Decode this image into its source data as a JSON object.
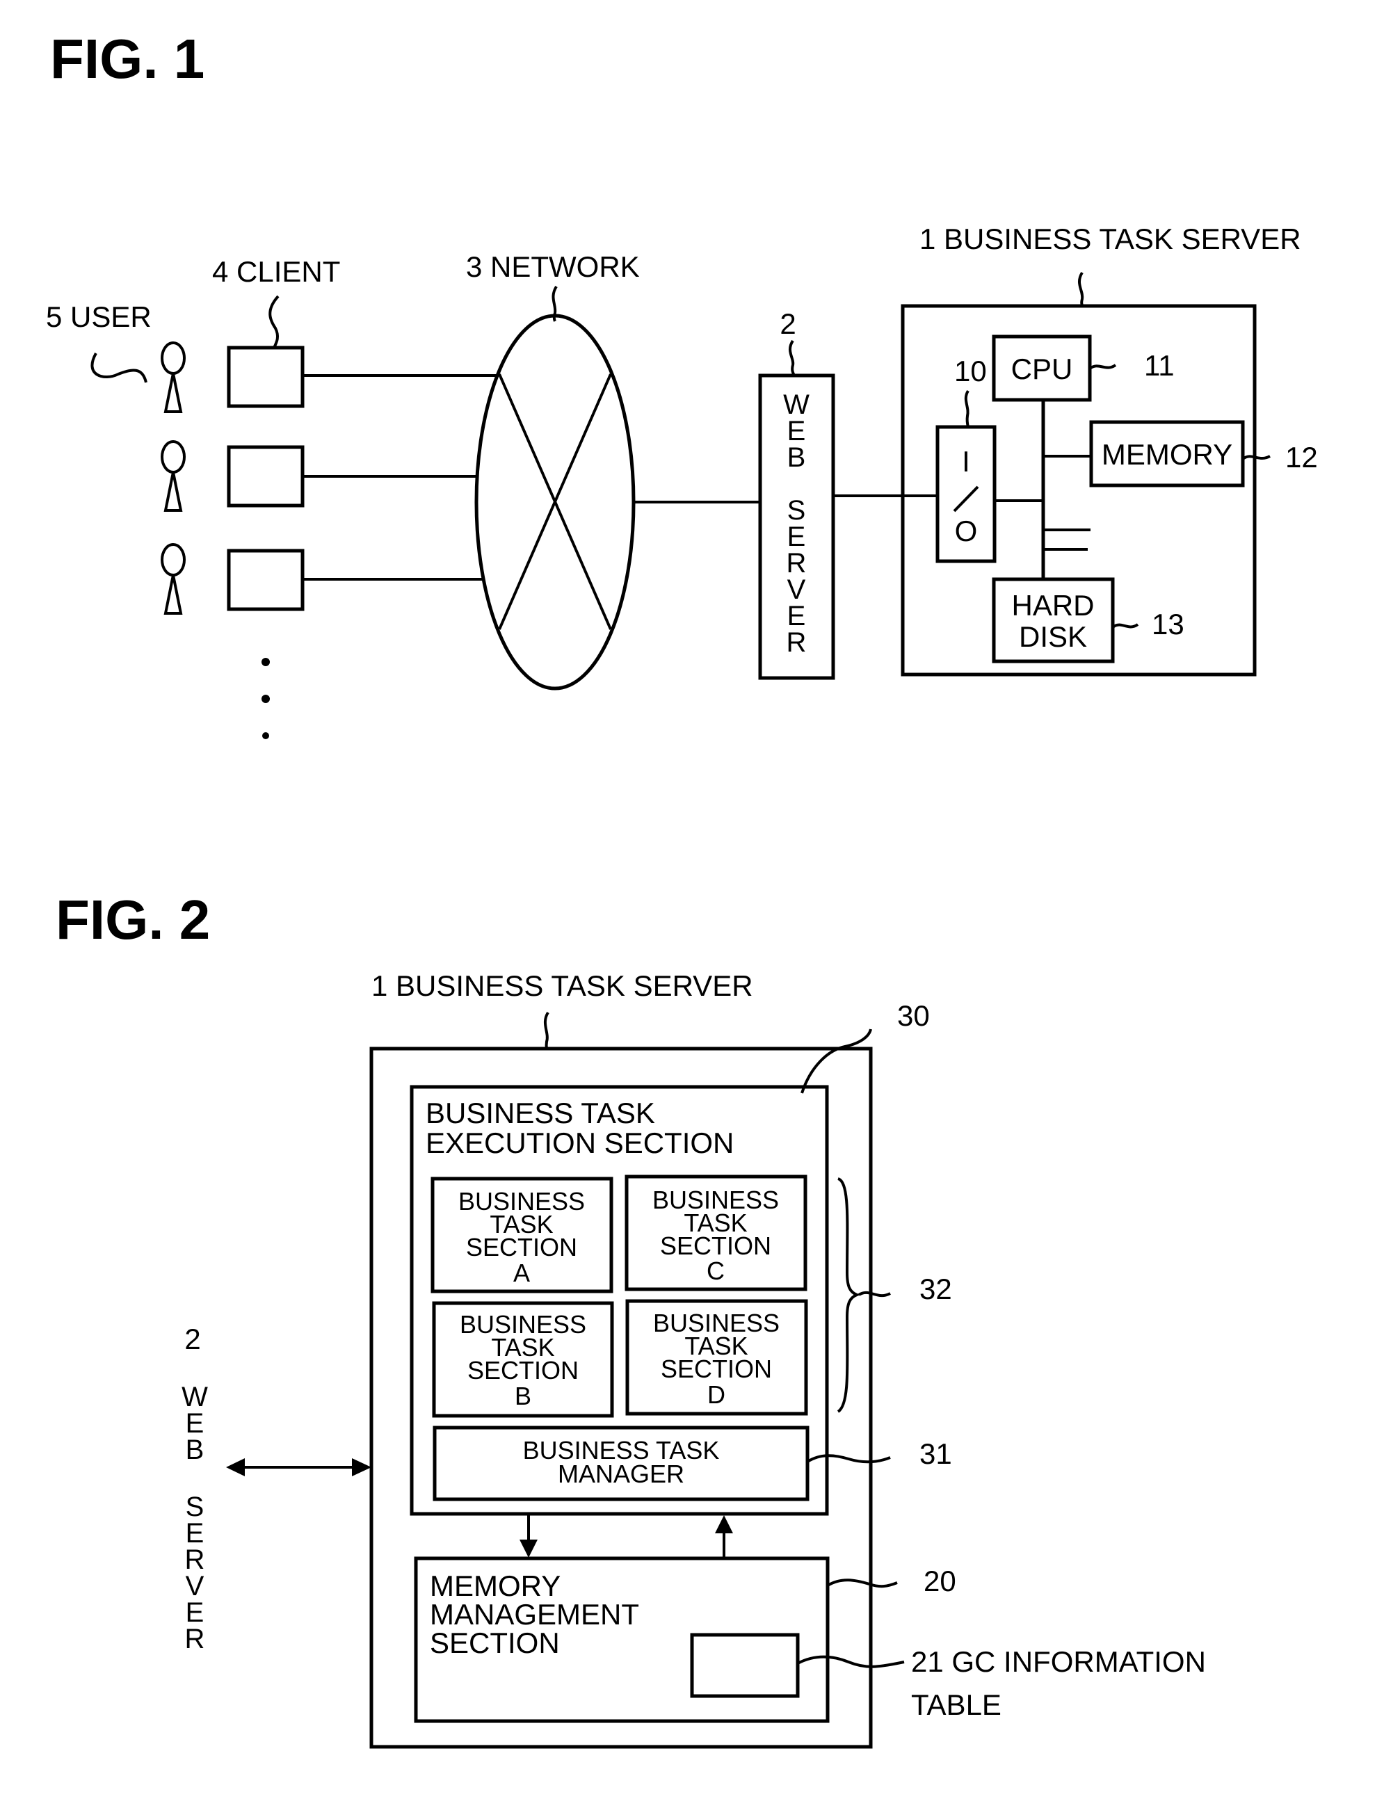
{
  "fig1": {
    "title": "FIG. 1",
    "labels": {
      "user": "5 USER",
      "client": "4 CLIENT",
      "network": "3 NETWORK",
      "web_server_ref": "2",
      "web_server_letters": [
        "W",
        "E",
        "B",
        "",
        "S",
        "E",
        "R",
        "V",
        "E",
        "R"
      ],
      "business_task_server": "1 BUSINESS TASK SERVER",
      "io_ref": "10",
      "io_letters": [
        "I",
        "/",
        "O"
      ],
      "cpu": "CPU",
      "cpu_ref": "11",
      "memory": "MEMORY",
      "memory_ref": "12",
      "hard_disk_line1": "HARD",
      "hard_disk_line2": "DISK",
      "hard_disk_ref": "13"
    },
    "user_count_shown": 3,
    "ellipsis": "⋮"
  },
  "fig2": {
    "title": "FIG. 2",
    "labels": {
      "business_task_server": "1 BUSINESS TASK SERVER",
      "execution_section_line1": "BUSINESS TASK",
      "execution_section_line2": "EXECUTION SECTION",
      "execution_ref": "30",
      "task_sections": [
        {
          "line1": "BUSINESS",
          "line2": "TASK",
          "line3": "SECTION",
          "letter": "A"
        },
        {
          "line1": "BUSINESS",
          "line2": "TASK",
          "line3": "SECTION",
          "letter": "C"
        },
        {
          "line1": "BUSINESS",
          "line2": "TASK",
          "line3": "SECTION",
          "letter": "B"
        },
        {
          "line1": "BUSINESS",
          "line2": "TASK",
          "line3": "SECTION",
          "letter": "D"
        }
      ],
      "task_sections_ref": "32",
      "manager_line1": "BUSINESS TASK",
      "manager_line2": "MANAGER",
      "manager_ref": "31",
      "memory_mgmt_line1": "MEMORY",
      "memory_mgmt_line2": "MANAGEMENT",
      "memory_mgmt_line3": "SECTION",
      "memory_mgmt_ref": "20",
      "gc_table_line1": "21 GC INFORMATION",
      "gc_table_line2": "TABLE",
      "web_server_ref": "2",
      "web_server_letters": [
        "W",
        "E",
        "B",
        "",
        "S",
        "E",
        "R",
        "V",
        "E",
        "R"
      ]
    }
  }
}
